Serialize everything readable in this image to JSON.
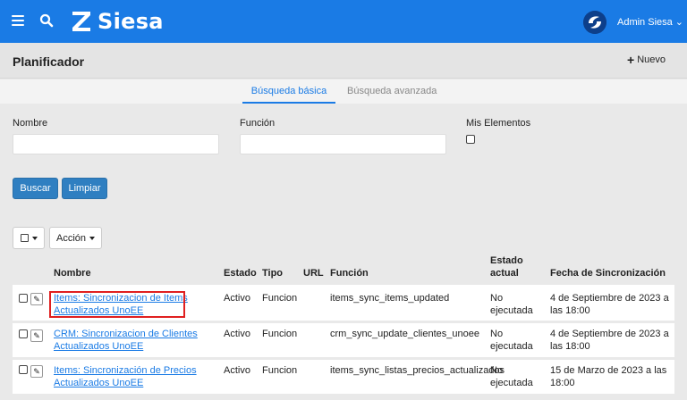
{
  "header": {
    "brand": "Siesa",
    "user_label": "Admin Siesa ⌄"
  },
  "page": {
    "title": "Planificador",
    "new_label": "Nuevo"
  },
  "tabs": [
    {
      "label": "Búsqueda básica",
      "active": true
    },
    {
      "label": "Búsqueda avanzada",
      "active": false
    }
  ],
  "filters": {
    "name_label": "Nombre",
    "name_value": "",
    "function_label": "Función",
    "function_value": "",
    "mine_label": "Mis Elementos",
    "mine_checked": false
  },
  "actions": {
    "search_label": "Buscar",
    "clear_label": "Limpiar",
    "bulk_action_label": "Acción"
  },
  "table": {
    "columns": {
      "name": "Nombre",
      "state": "Estado",
      "type": "Tipo",
      "url": "URL",
      "function": "Función",
      "current_state_1": "Estado",
      "current_state_2": "actual",
      "sync_date": "Fecha de Sincronización"
    },
    "rows": [
      {
        "name_1": "Items: Sincronizacion de Items",
        "name_2": "Actualizados UnoEE",
        "state": "Activo",
        "type": "Funcion",
        "url": "",
        "function": "items_sync_items_updated",
        "current_1": "No",
        "current_2": "ejecutada",
        "date_1": "4 de Septiembre de 2023 a",
        "date_2": "las 18:00"
      },
      {
        "name_1": "CRM: Sincronizacion de Clientes",
        "name_2": "Actualizados UnoEE",
        "state": "Activo",
        "type": "Funcion",
        "url": "",
        "function": "crm_sync_update_clientes_unoee",
        "current_1": "No",
        "current_2": "ejecutada",
        "date_1": "4 de Septiembre de 2023 a",
        "date_2": "las 18:00"
      },
      {
        "name_1": "Items: Sincronización de Precios",
        "name_2": "Actualizados UnoEE",
        "state": "Activo",
        "type": "Funcion",
        "url": "",
        "function": "items_sync_listas_precios_actualizados",
        "current_1": "No",
        "current_2": "ejecutada",
        "date_1": "15 de Marzo de 2023 a las",
        "date_2": "18:00"
      }
    ]
  },
  "colors": {
    "primary": "#1a7be5",
    "button": "#2f7fc1",
    "highlight": "#e02020"
  }
}
